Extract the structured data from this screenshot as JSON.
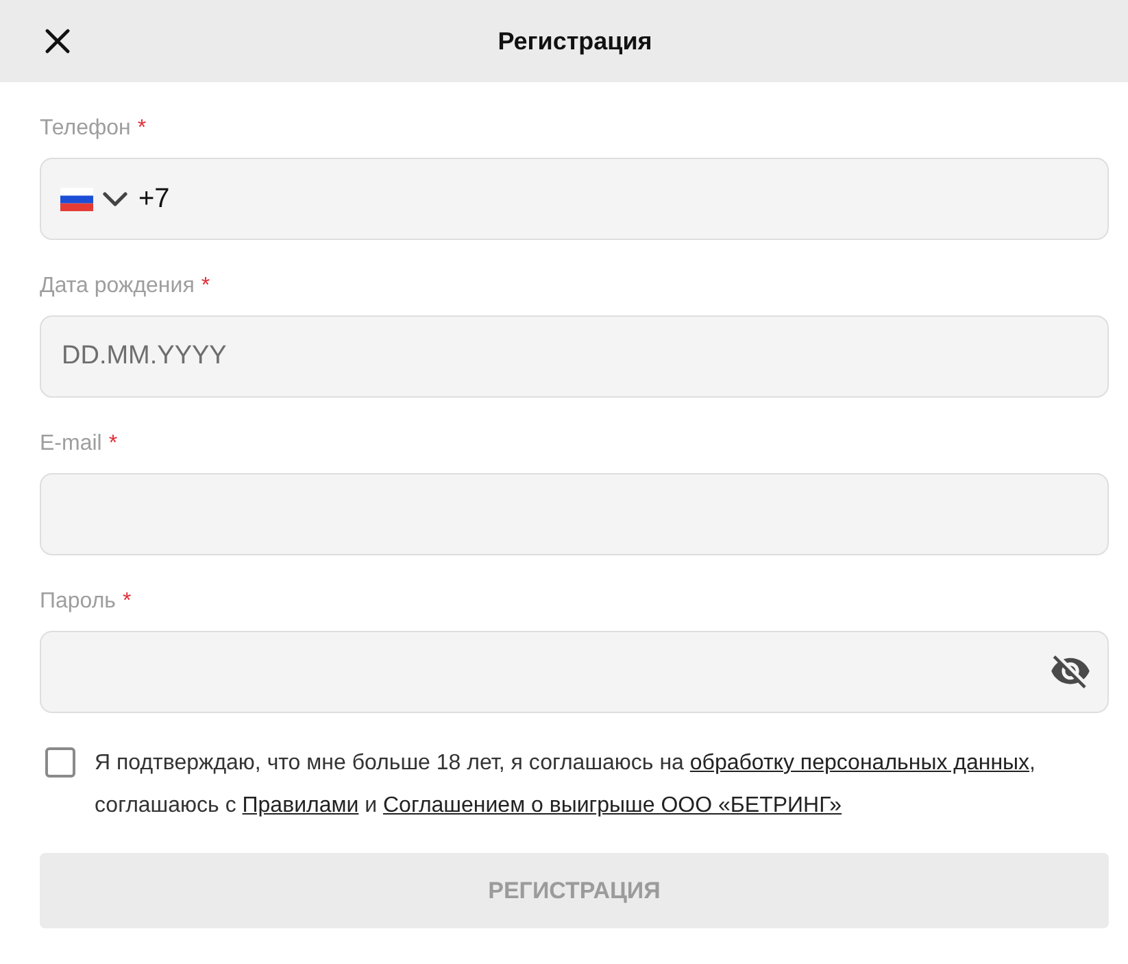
{
  "header": {
    "title": "Регистрация"
  },
  "fields": [
    {
      "kind": "phone",
      "label": "Телефон",
      "required_mark": "*",
      "value": "+7"
    },
    {
      "kind": "text",
      "label": "Дата рождения",
      "required_mark": "*",
      "placeholder": "DD.MM.YYYY"
    },
    {
      "kind": "text",
      "label": "E-mail",
      "required_mark": "*"
    },
    {
      "kind": "password",
      "label": "Пароль",
      "required_mark": "*"
    }
  ],
  "consent": {
    "checked": false,
    "parts": [
      {
        "kind": "text",
        "text": "Я подтверждаю, что мне больше 18 лет, я соглашаюсь на "
      },
      {
        "kind": "link",
        "text": "обработку персональных данных"
      },
      {
        "kind": "text",
        "text": ", соглашаюсь с "
      },
      {
        "kind": "link",
        "text": "Правилами"
      },
      {
        "kind": "text",
        "text": " и "
      },
      {
        "kind": "link",
        "text": "Соглашением о выигрыше ООО «БЕТРИНГ»"
      }
    ]
  },
  "submit": {
    "label": "РЕГИСТРАЦИЯ",
    "disabled": true
  }
}
